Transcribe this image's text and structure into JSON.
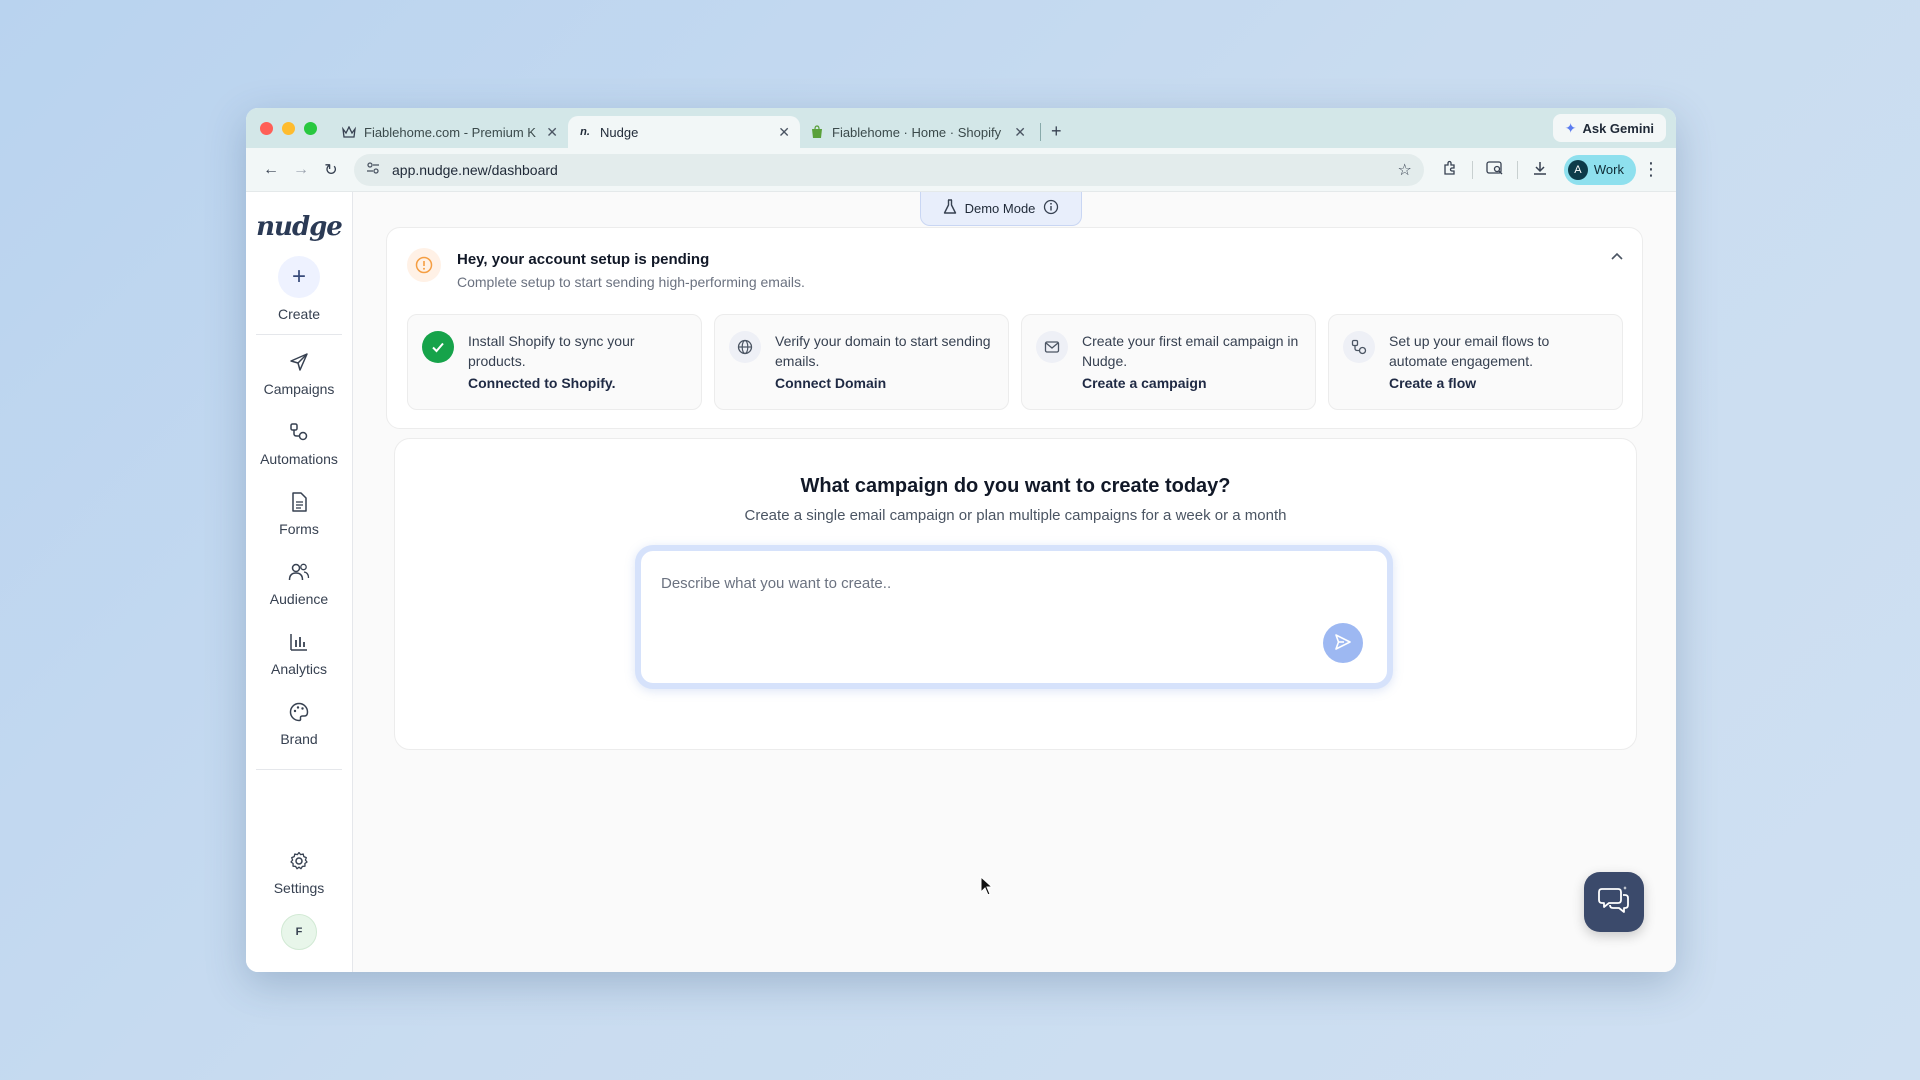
{
  "browser": {
    "tabs": [
      {
        "title": "Fiablehome.com - Premium K",
        "active": false
      },
      {
        "title": "Nudge",
        "active": true
      },
      {
        "title": "Fiablehome · Home · Shopify",
        "active": false
      }
    ],
    "ask_gemini": "Ask Gemini",
    "url": "app.nudge.new/dashboard",
    "profile_initial": "A",
    "profile_label": "Work"
  },
  "sidebar": {
    "logo": "nudge",
    "create_label": "Create",
    "items": [
      {
        "label": "Campaigns",
        "icon": "send-icon"
      },
      {
        "label": "Automations",
        "icon": "flow-icon"
      },
      {
        "label": "Forms",
        "icon": "document-icon"
      },
      {
        "label": "Audience",
        "icon": "users-icon"
      },
      {
        "label": "Analytics",
        "icon": "bar-chart-icon"
      },
      {
        "label": "Brand",
        "icon": "palette-icon"
      }
    ],
    "settings_label": "Settings",
    "avatar_initial": "F"
  },
  "demo_mode": {
    "label": "Demo Mode"
  },
  "setup": {
    "title": "Hey, your account setup is pending",
    "subtitle": "Complete setup to start sending high-performing emails.",
    "steps": [
      {
        "text": "Install Shopify to sync your products.",
        "link": "Connected to Shopify.",
        "done": true
      },
      {
        "text": "Verify your domain to start sending emails.",
        "link": "Connect Domain",
        "done": false
      },
      {
        "text": "Create your first email campaign in Nudge.",
        "link": "Create a campaign",
        "done": false
      },
      {
        "text": "Set up your email flows to automate engagement.",
        "link": "Create a flow",
        "done": false
      }
    ]
  },
  "create": {
    "title": "What campaign do you want to create today?",
    "subtitle": "Create a single email campaign or plan multiple campaigns for a week or a month",
    "placeholder": "Describe what you want to create.."
  },
  "colors": {
    "accent": "#3b4a6b",
    "success": "#16a34a",
    "send_button": "#9db8f2",
    "profile_chip": "#8ee0ee"
  }
}
